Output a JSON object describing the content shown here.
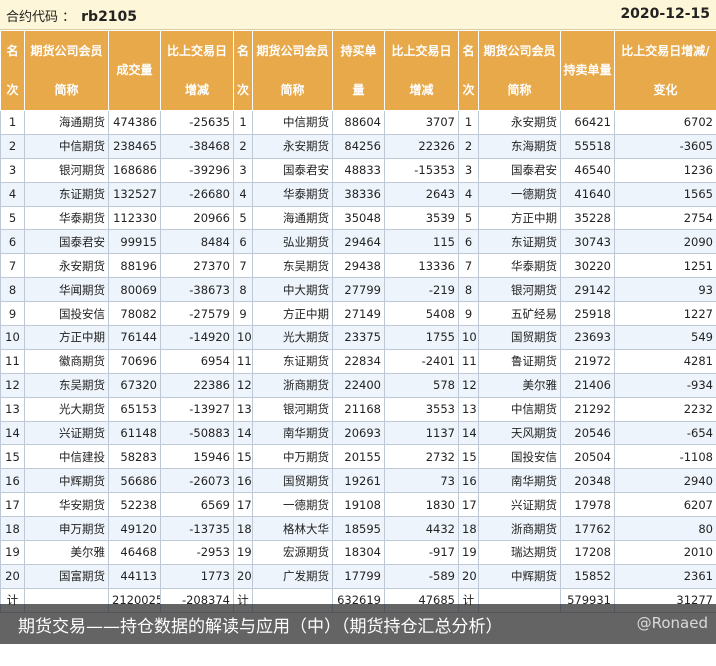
{
  "header": {
    "code_label": "合约代码 ：",
    "code_value": "rb2105",
    "date": "2020-12-15"
  },
  "columns": [
    "名次",
    "期货公司会员简称",
    "成交量",
    "比上交易日增减",
    "名次",
    "期货公司会员简称",
    "持买单量",
    "比上交易日增减",
    "名次",
    "期货公司会员简称",
    "持卖单量",
    "比上交易日增减/变化"
  ],
  "rows": [
    [
      "1",
      "海通期货",
      "474386",
      "-25635",
      "1",
      "中信期货",
      "88604",
      "3707",
      "1",
      "永安期货",
      "66421",
      "6702"
    ],
    [
      "2",
      "中信期货",
      "238465",
      "-38468",
      "2",
      "永安期货",
      "84256",
      "22326",
      "2",
      "东海期货",
      "55518",
      "-3605"
    ],
    [
      "3",
      "银河期货",
      "168686",
      "-39296",
      "3",
      "国泰君安",
      "48833",
      "-15353",
      "3",
      "国泰君安",
      "46540",
      "1236"
    ],
    [
      "4",
      "东证期货",
      "132527",
      "-26680",
      "4",
      "华泰期货",
      "38336",
      "2643",
      "4",
      "一德期货",
      "41640",
      "1565"
    ],
    [
      "5",
      "华泰期货",
      "112330",
      "20966",
      "5",
      "海通期货",
      "35048",
      "3539",
      "5",
      "方正中期",
      "35228",
      "2754"
    ],
    [
      "6",
      "国泰君安",
      "99915",
      "8484",
      "6",
      "弘业期货",
      "29464",
      "115",
      "6",
      "东证期货",
      "30743",
      "2090"
    ],
    [
      "7",
      "永安期货",
      "88196",
      "27370",
      "7",
      "东吴期货",
      "29438",
      "13336",
      "7",
      "华泰期货",
      "30220",
      "1251"
    ],
    [
      "8",
      "华闻期货",
      "80069",
      "-38673",
      "8",
      "中大期货",
      "27799",
      "-219",
      "8",
      "银河期货",
      "29142",
      "93"
    ],
    [
      "9",
      "国投安信",
      "78082",
      "-27579",
      "9",
      "方正中期",
      "27149",
      "5408",
      "9",
      "五矿经易",
      "25918",
      "1227"
    ],
    [
      "10",
      "方正中期",
      "76144",
      "-14920",
      "10",
      "光大期货",
      "23375",
      "1755",
      "10",
      "国贸期货",
      "23693",
      "549"
    ],
    [
      "11",
      "徽商期货",
      "70696",
      "6954",
      "11",
      "东证期货",
      "22834",
      "-2401",
      "11",
      "鲁证期货",
      "21972",
      "4281"
    ],
    [
      "12",
      "东吴期货",
      "67320",
      "22386",
      "12",
      "浙商期货",
      "22400",
      "578",
      "12",
      "美尔雅",
      "21406",
      "-934"
    ],
    [
      "13",
      "光大期货",
      "65153",
      "-13927",
      "13",
      "银河期货",
      "21168",
      "3553",
      "13",
      "中信期货",
      "21292",
      "2232"
    ],
    [
      "14",
      "兴证期货",
      "61148",
      "-50883",
      "14",
      "南华期货",
      "20693",
      "1137",
      "14",
      "天风期货",
      "20546",
      "-654"
    ],
    [
      "15",
      "中信建投",
      "58283",
      "15946",
      "15",
      "中万期货",
      "20155",
      "2732",
      "15",
      "国投安信",
      "20504",
      "-1108"
    ],
    [
      "16",
      "中辉期货",
      "56686",
      "-26073",
      "16",
      "国贸期货",
      "19261",
      "73",
      "16",
      "南华期货",
      "20348",
      "2940"
    ],
    [
      "17",
      "华安期货",
      "52238",
      "6569",
      "17",
      "一德期货",
      "19108",
      "1830",
      "17",
      "兴证期货",
      "17978",
      "6207"
    ],
    [
      "18",
      "申万期货",
      "49120",
      "-13735",
      "18",
      "格林大华",
      "18595",
      "4432",
      "18",
      "浙商期货",
      "17762",
      "80"
    ],
    [
      "19",
      "美尔雅",
      "46468",
      "-2953",
      "19",
      "宏源期货",
      "18304",
      "-917",
      "19",
      "瑞达期货",
      "17208",
      "2010"
    ],
    [
      "20",
      "国富期货",
      "44113",
      "1773",
      "20",
      "广发期货",
      "17799",
      "-589",
      "20",
      "中辉期货",
      "15852",
      "2361"
    ],
    [
      "计",
      "",
      "2120025",
      "-208374",
      "计",
      "",
      "632619",
      "47685",
      "计",
      "",
      "579931",
      "31277"
    ]
  ],
  "caption": {
    "title": "期货交易——持仓数据的解读与应用（中）（期货持仓汇总分析）",
    "watermark": "@Ronaed"
  }
}
